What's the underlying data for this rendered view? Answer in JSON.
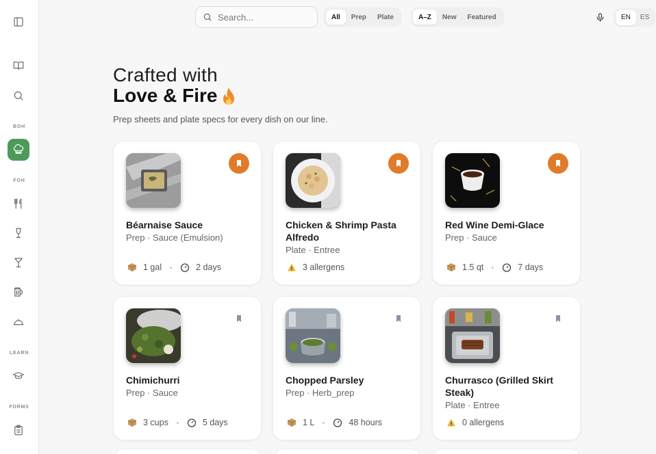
{
  "sidebar": {
    "sections": [
      "BOH",
      "FOH",
      "LEARN",
      "FORMS"
    ],
    "icons": [
      "sidebar-toggle-icon",
      "book-icon",
      "search-icon",
      "chef-hat-icon",
      "utensils-icon",
      "wine-glass-icon",
      "cocktail-icon",
      "beer-mug-icon",
      "cloche-icon",
      "graduation-cap-icon",
      "clipboard-icon"
    ]
  },
  "search": {
    "placeholder": "Search..."
  },
  "filter_type": {
    "options": [
      "All",
      "Prep",
      "Plate"
    ],
    "selected": "All"
  },
  "sort": {
    "options": [
      "A–Z",
      "New",
      "Featured"
    ],
    "selected": "A–Z"
  },
  "language": {
    "options": [
      "EN",
      "ES"
    ],
    "selected": "EN"
  },
  "hero": {
    "line1": "Crafted with",
    "line2": "Love & Fire",
    "subtitle": "Prep sheets and plate specs for every dish on our line."
  },
  "colors": {
    "accent": "#e07b2a",
    "active_nav": "#4d9a5b"
  },
  "cards": [
    {
      "title": "Béarnaise Sauce",
      "meta": "Prep · Sauce (Emulsion)",
      "bookmarked": true,
      "kind": "prep",
      "yield": "1 gal",
      "shelf": "2 days"
    },
    {
      "title": "Chicken & Shrimp Pasta Alfredo",
      "meta": "Plate · Entree",
      "bookmarked": true,
      "kind": "plate",
      "allergens": "3 allergens"
    },
    {
      "title": "Red Wine Demi-Glace",
      "meta": "Prep · Sauce",
      "bookmarked": true,
      "kind": "prep",
      "yield": "1.5 qt",
      "shelf": "7 days"
    },
    {
      "title": "Chimichurri",
      "meta": "Prep · Sauce",
      "bookmarked": false,
      "kind": "prep",
      "yield": "3 cups",
      "shelf": "5 days"
    },
    {
      "title": "Chopped Parsley",
      "meta": "Prep · Herb_prep",
      "bookmarked": false,
      "kind": "prep",
      "yield": "1 L",
      "shelf": "48 hours"
    },
    {
      "title": "Churrasco (Grilled Skirt Steak)",
      "meta": "Plate · Entree",
      "bookmarked": false,
      "kind": "plate",
      "allergens": "0 allergens"
    }
  ]
}
